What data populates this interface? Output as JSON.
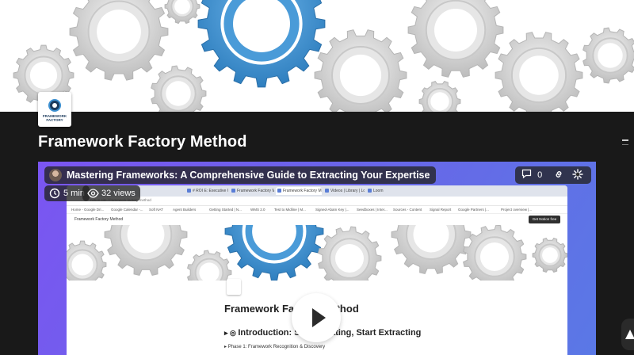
{
  "page": {
    "title": "Framework Factory Method",
    "logo_text": "FRAMEWORK\nFACTORY"
  },
  "video": {
    "title": "Mastering Frameworks: A Comprehensive Guide to Extracting Your Expertise",
    "duration": "5 min",
    "views": "32 views",
    "comments_count": "0"
  },
  "screen": {
    "tabs": [
      "# ROI E: Executive Co...",
      "Framework Factory M...",
      "Framework Factory M",
      "Videos | Library | Loom",
      "Loom"
    ],
    "url": "notion.site / framework-factory-method",
    "bookmarks": [
      "Home - Google Dri...",
      "Google Calendar -...",
      "Soft NAT",
      "Agent Builders",
      "Getting Started | N...",
      "WMS 2.0",
      "Test to Midline | M...",
      "Signed-Abam Key |...",
      "Seedboxes | Inter...",
      "Sources - Content",
      "Signal Report",
      "Google Partners |...",
      "Project overview |..."
    ],
    "crumb": "Framework Factory Method",
    "notion_button": "Get Notion free",
    "heading": "Framework Factory Method",
    "section": "Introduction: Stop Creating, Start Extracting",
    "phase": "Phase 1: Framework Recognition & Discovery"
  },
  "colors": {
    "gear_blue": "#3b8fd0",
    "gear_gray": "#d9d9d9",
    "background": "#191919",
    "video_gradient_start": "#7b55f2",
    "video_gradient_end": "#5a78e6"
  }
}
